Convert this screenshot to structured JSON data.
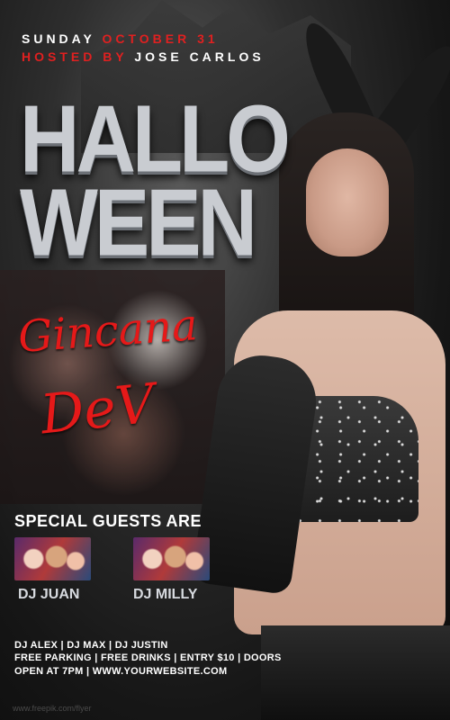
{
  "header": {
    "day": "SUNDAY",
    "date": "OCTOBER 31",
    "host_prefix": "HOSTED BY",
    "host_name": "JOSE CARLOS"
  },
  "title": {
    "line1": "HALLO",
    "line2": "WEEN"
  },
  "script_text": {
    "line1": "Gincana",
    "line2": "DeV"
  },
  "guests": {
    "heading": "SPECIAL GUESTS ARE",
    "items": [
      {
        "name": "DJ JUAN"
      },
      {
        "name": "DJ MILLY"
      }
    ]
  },
  "info": {
    "line1": "DJ ALEX | DJ MAX | DJ JUSTIN",
    "line2": "FREE  PARKING | FREE DRINKS | ENTRY $10 | DOORS",
    "line3": "OPEN AT 7PM |  WWW.YOURWEBSITE.COM"
  },
  "footer": {
    "watermark": "www.freepik.com/flyer"
  },
  "colors": {
    "accent_red": "#e02020",
    "title_silver": "#c9ccd1",
    "script_red": "#e51919"
  }
}
